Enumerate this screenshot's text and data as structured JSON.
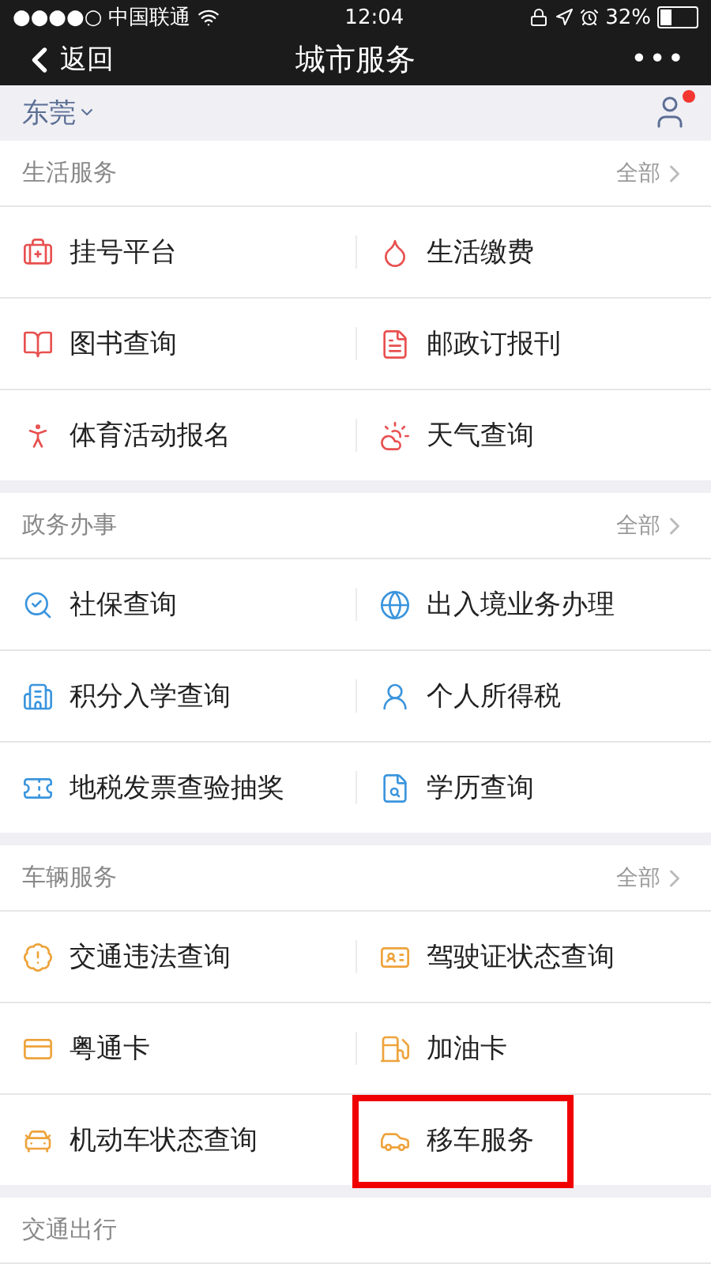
{
  "status_bar": {
    "signal": "●●●●○",
    "carrier": "中国联通",
    "time": "12:04",
    "battery": "32%"
  },
  "nav_bar": {
    "back": "返回",
    "title": "城市服务",
    "more": "•••"
  },
  "city": {
    "name": "东莞",
    "notification": true
  },
  "sections": [
    {
      "title": "生活服务",
      "more": "全部",
      "color": "#e8504f",
      "items": [
        {
          "label": "挂号平台",
          "highlighted": false
        },
        {
          "label": "生活缴费",
          "highlighted": false
        },
        {
          "label": "图书查询",
          "highlighted": false
        },
        {
          "label": "邮政订报刊",
          "highlighted": false
        },
        {
          "label": "体育活动报名",
          "highlighted": false
        },
        {
          "label": "天气查询",
          "highlighted": false
        }
      ]
    },
    {
      "title": "政务办事",
      "more": "全部",
      "color": "#3b95dd",
      "items": [
        {
          "label": "社保查询",
          "highlighted": false
        },
        {
          "label": "出入境业务办理",
          "highlighted": false
        },
        {
          "label": "积分入学查询",
          "highlighted": false
        },
        {
          "label": "个人所得税",
          "highlighted": false
        },
        {
          "label": "地税发票查验抽奖",
          "highlighted": false
        },
        {
          "label": "学历查询",
          "highlighted": false
        }
      ]
    },
    {
      "title": "车辆服务",
      "more": "全部",
      "color": "#eea33b",
      "items": [
        {
          "label": "交通违法查询",
          "highlighted": false
        },
        {
          "label": "驾驶证状态查询",
          "highlighted": false
        },
        {
          "label": "粤通卡",
          "highlighted": false
        },
        {
          "label": "加油卡",
          "highlighted": false
        },
        {
          "label": "机动车状态查询",
          "highlighted": false
        },
        {
          "label": "移车服务",
          "highlighted": true
        }
      ]
    },
    {
      "title": "交通出行"
    }
  ]
}
